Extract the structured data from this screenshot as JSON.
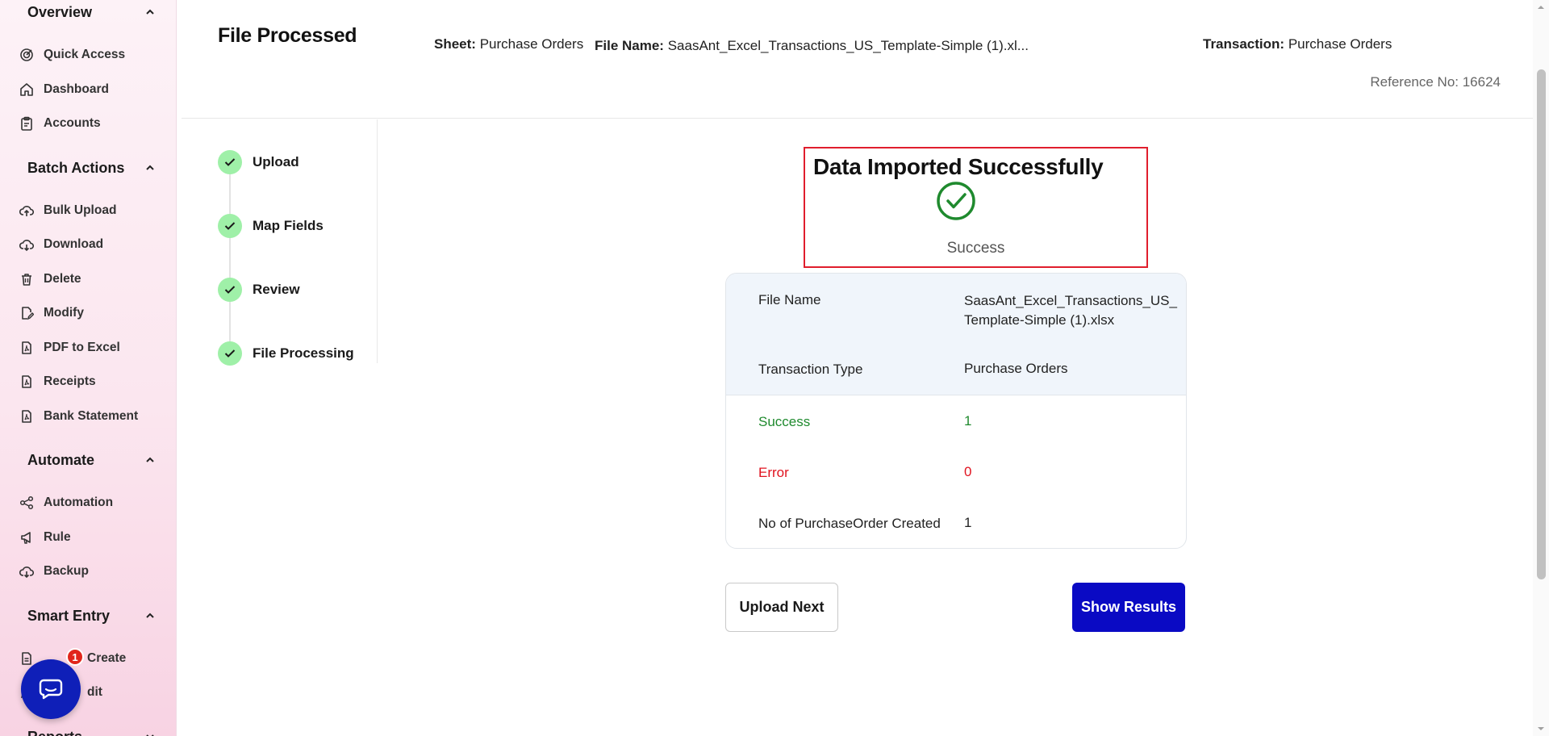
{
  "sidebar": {
    "sections": [
      {
        "title": "Overview"
      },
      {
        "title": "Batch Actions"
      },
      {
        "title": "Automate"
      },
      {
        "title": "Smart Entry"
      },
      {
        "title": "Reports"
      }
    ],
    "items": [
      {
        "label": "Quick Access",
        "icon": "quick-access-icon"
      },
      {
        "label": "Dashboard",
        "icon": "home-icon"
      },
      {
        "label": "Accounts",
        "icon": "clipboard-icon"
      },
      {
        "label": "Bulk Upload",
        "icon": "cloud-upload-icon"
      },
      {
        "label": "Download",
        "icon": "cloud-download-icon"
      },
      {
        "label": "Delete",
        "icon": "trash-icon"
      },
      {
        "label": "Modify",
        "icon": "edit-file-icon"
      },
      {
        "label": "PDF to Excel",
        "icon": "pdf-file-icon"
      },
      {
        "label": "Receipts",
        "icon": "receipt-icon"
      },
      {
        "label": "Bank Statement",
        "icon": "pdf-file-icon"
      },
      {
        "label": "Automation",
        "icon": "share-nodes-icon"
      },
      {
        "label": "Rule",
        "icon": "megaphone-icon"
      },
      {
        "label": "Backup",
        "icon": "cloud-download-icon"
      },
      {
        "label": "Create",
        "icon": "document-icon"
      },
      {
        "label": "dit",
        "icon": "edit-icon"
      }
    ],
    "chat_badge": "1"
  },
  "header": {
    "title": "File Processed",
    "sheet_label": "Sheet:",
    "sheet_value": "Purchase Orders",
    "file_label": "File Name:",
    "file_value": "SaasAnt_Excel_Transactions_US_Template-Simple (1).xl...",
    "transaction_label": "Transaction:",
    "transaction_value": "Purchase Orders",
    "reference": "Reference No: 16624"
  },
  "steps": [
    {
      "label": "Upload"
    },
    {
      "label": "Map Fields"
    },
    {
      "label": "Review"
    },
    {
      "label": "File Processing"
    }
  ],
  "result": {
    "title": "Data Imported Successfully",
    "status": "Success"
  },
  "summary": {
    "file_name_label": "File Name",
    "file_name_line1": "SaasAnt_Excel_Transactions_US_",
    "file_name_line2": "Template-Simple (1).xlsx",
    "transaction_type_label": "Transaction Type",
    "transaction_type_value": "Purchase Orders",
    "success_label": "Success",
    "success_value": "1",
    "error_label": "Error",
    "error_value": "0",
    "created_label": "No of PurchaseOrder Created",
    "created_value": "1"
  },
  "actions": {
    "upload_next": "Upload Next",
    "show_results": "Show Results"
  },
  "colors": {
    "primary": "#0a0ac4",
    "success": "#1f8a2e",
    "error": "#e0131f",
    "step_done": "#9ff0a8",
    "highlight_border": "#e01e2d"
  }
}
